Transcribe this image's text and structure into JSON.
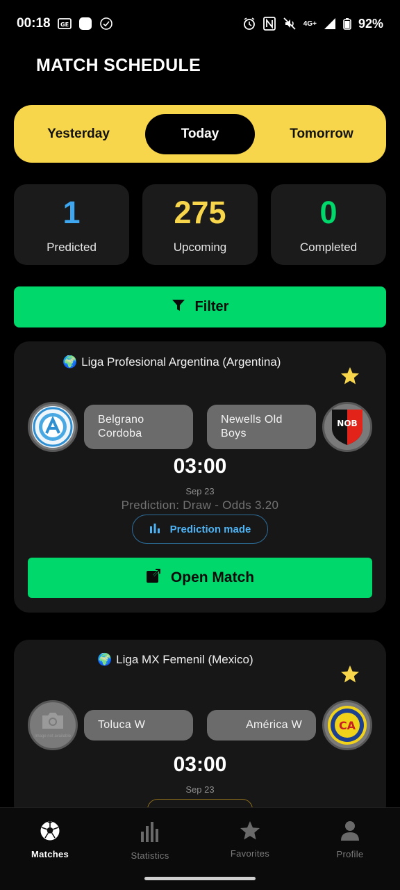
{
  "status_bar": {
    "time": "00:18",
    "network": "4G+",
    "battery": "92%"
  },
  "header": {
    "title": "MATCH SCHEDULE"
  },
  "day_tabs": [
    {
      "label": "Yesterday",
      "active": false
    },
    {
      "label": "Today",
      "active": true
    },
    {
      "label": "Tomorrow",
      "active": false
    }
  ],
  "stats": [
    {
      "value": "1",
      "label": "Predicted",
      "color": "#3ea7f0"
    },
    {
      "value": "275",
      "label": "Upcoming",
      "color": "#f8d64c"
    },
    {
      "value": "0",
      "label": "Completed",
      "color": "#00d86b"
    }
  ],
  "filter": {
    "label": "Filter"
  },
  "matches": [
    {
      "league": "Liga Profesional Argentina (Argentina)",
      "home_team": "Belgrano Cordoba",
      "away_team": "Newells Old Boys",
      "time": "03:00",
      "date": "Sep 23",
      "prediction": "Prediction: Draw - Odds 3.20",
      "badge": "Prediction made",
      "open_label": "Open Match",
      "away_logo_text": "NOB"
    },
    {
      "league": "Liga MX Femenil (Mexico)",
      "home_team": "Toluca W",
      "away_team": "América W",
      "time": "03:00",
      "date": "Sep 23",
      "home_logo_placeholder": "Image not available",
      "away_logo_text": "CA"
    }
  ],
  "nav": [
    {
      "label": "Matches",
      "icon": "soccer-ball-icon",
      "active": true
    },
    {
      "label": "Statistics",
      "icon": "bar-chart-icon",
      "active": false
    },
    {
      "label": "Favorites",
      "icon": "star-icon",
      "active": false
    },
    {
      "label": "Profile",
      "icon": "person-icon",
      "active": false
    }
  ],
  "colors": {
    "accent_yellow": "#f8d64c",
    "accent_green": "#00d86b",
    "accent_blue": "#3ea7f0"
  }
}
